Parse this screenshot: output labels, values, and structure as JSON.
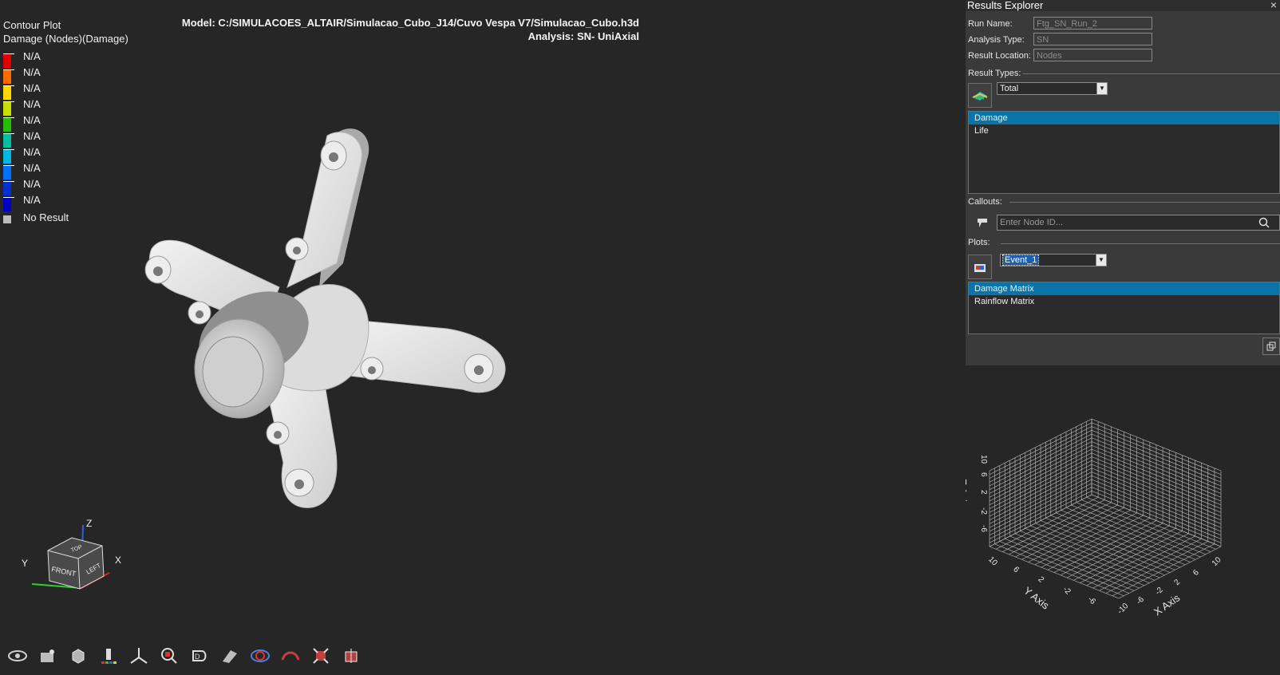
{
  "legend": {
    "title": "Contour Plot",
    "subtitle": "Damage (Nodes)(Damage)",
    "entries": [
      {
        "label": "N/A",
        "color": "#e00000"
      },
      {
        "label": "N/A",
        "color": "#ff6a00"
      },
      {
        "label": "N/A",
        "color": "#ffd800"
      },
      {
        "label": "N/A",
        "color": "#c8e000"
      },
      {
        "label": "N/A",
        "color": "#22c000"
      },
      {
        "label": "N/A",
        "color": "#00c0a0"
      },
      {
        "label": "N/A",
        "color": "#00b8e0"
      },
      {
        "label": "N/A",
        "color": "#0070ff"
      },
      {
        "label": "N/A",
        "color": "#0030d0"
      },
      {
        "label": "N/A",
        "color": "#0000c0"
      }
    ],
    "no_result_label": "No Result",
    "no_result_color": "#bdbdbd"
  },
  "model_info": {
    "model": "Model: C:/SIMULACOES_ALTAIR/Simulacao_Cubo_J14/Cuvo Vespa V7/Simulacao_Cubo.h3d",
    "analysis": "Analysis: SN- UniAxial"
  },
  "triad": {
    "faces": {
      "front": "FRONT",
      "left": "LEFT",
      "top": "TOP"
    },
    "axes": {
      "x": "X",
      "y": "Y",
      "z": "Z"
    }
  },
  "toolbar": {
    "icons": [
      "eye-icon",
      "camera-icon",
      "cube-icon",
      "contour-icon",
      "axis-icon",
      "zoom-icon",
      "3d-view-icon",
      "section-icon",
      "morph-icon",
      "deform-icon",
      "fit-icon",
      "box-icon"
    ]
  },
  "results_explorer": {
    "title": "Results Explorer",
    "close": "×",
    "run_name_label": "Run Name:",
    "run_name_value": "Ftg_SN_Run_2",
    "analysis_type_label": "Analysis Type:",
    "analysis_type_value": "SN",
    "result_location_label": "Result Location:",
    "result_location_value": "Nodes",
    "result_types_label": "Result Types:",
    "result_types_selected": "Total",
    "result_list": [
      {
        "label": "Damage",
        "selected": true
      },
      {
        "label": "Life",
        "selected": false
      }
    ],
    "callouts_label": "Callouts:",
    "node_placeholder": "Enter Node ID...",
    "plots_label": "Plots:",
    "plots_selected": "Event_1",
    "plot_list": [
      {
        "label": "Damage Matrix",
        "selected": true
      },
      {
        "label": "Rainflow Matrix",
        "selected": false
      }
    ]
  },
  "matrix_plot": {
    "z_axis_label": "Z Axis",
    "y_axis_label": "Y Axis",
    "x_axis_label": "X Axis",
    "z_ticks": [
      "10",
      "6",
      "2",
      "-2",
      "-6"
    ],
    "y_ticks": [
      "10",
      "6",
      "2",
      "-2",
      "-6"
    ],
    "x_ticks": [
      "-10",
      "-6",
      "-2",
      "2",
      "6",
      "10"
    ]
  }
}
